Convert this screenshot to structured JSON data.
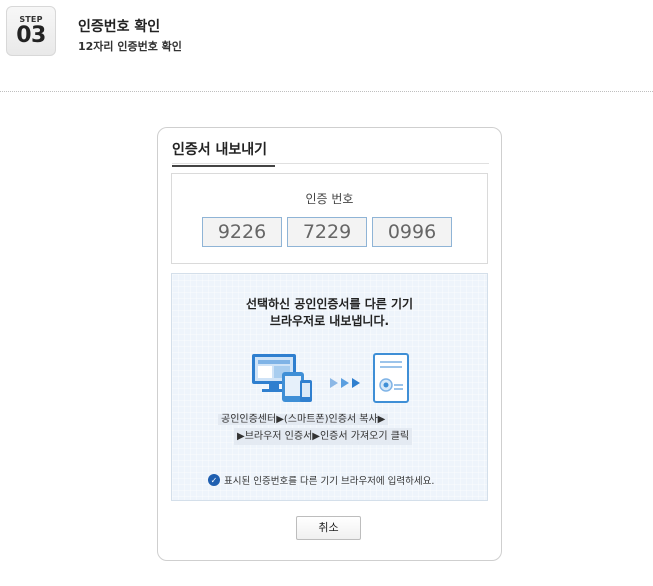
{
  "step": {
    "label": "STEP",
    "number": "03",
    "title": "인증번호 확인",
    "subtitle": "12자리 인증번호 확인"
  },
  "dialog": {
    "title": "인증서 내보내기",
    "cert_label": "인증 번호",
    "codes": [
      "9226",
      "7229",
      "0996"
    ],
    "message_line1": "선택하신 공인인증서를 다른 기기",
    "message_line2": "브라우저로 내보냅니다.",
    "steps_line1": "공인인증센터▶(스마트폰)인증서 복사▶",
    "steps_line2": "▶브라우저 인증서▶인증서 가져오기 클릭",
    "notice": "표시된 인증번호를 다른 기기 브라우저에 입력하세요.",
    "cancel_label": "취소"
  },
  "colors": {
    "code_border": "#8fb4d6",
    "info_background": "#eef4fb",
    "check_icon": "#1f5fb0",
    "illustration_blue": "#3f8fd6"
  },
  "icons": [
    "check-circle-icon",
    "computer-devices-icon",
    "arrows-icon",
    "certificate-document-icon"
  ]
}
